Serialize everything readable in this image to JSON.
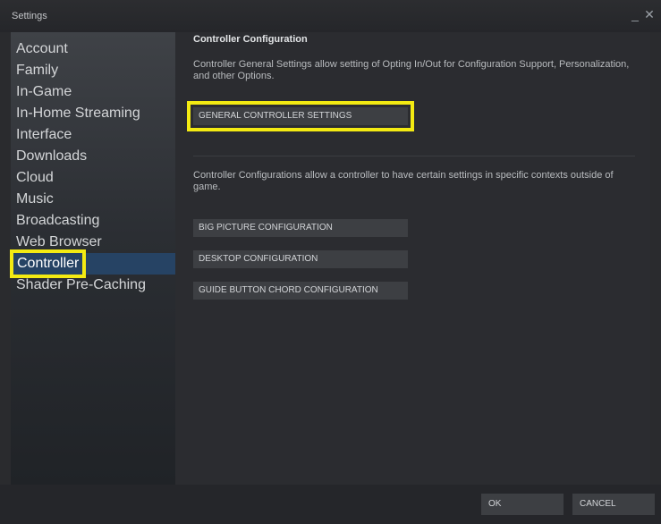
{
  "window": {
    "title": "Settings",
    "minimize_glyph": "_",
    "close_glyph": "✕"
  },
  "sidebar": {
    "items": [
      {
        "label": "Account"
      },
      {
        "label": "Family"
      },
      {
        "label": "In-Game"
      },
      {
        "label": "In-Home Streaming"
      },
      {
        "label": "Interface"
      },
      {
        "label": "Downloads"
      },
      {
        "label": "Cloud"
      },
      {
        "label": "Music"
      },
      {
        "label": "Broadcasting"
      },
      {
        "label": "Web Browser"
      },
      {
        "label": "Controller"
      },
      {
        "label": "Shader Pre-Caching"
      }
    ],
    "selected": "Controller"
  },
  "main": {
    "title": "Controller Configuration",
    "general_description": "Controller General Settings allow setting of Opting In/Out for Configuration Support, Personalization, and other Options.",
    "general_button": "GENERAL CONTROLLER SETTINGS",
    "configs_description": "Controller Configurations allow a controller to have certain settings in specific contexts outside of game.",
    "big_picture_button": "BIG PICTURE CONFIGURATION",
    "desktop_button": "DESKTOP CONFIGURATION",
    "guide_chord_button": "GUIDE BUTTON CHORD CONFIGURATION"
  },
  "footer": {
    "ok_label": "OK",
    "cancel_label": "CANCEL"
  },
  "colors": {
    "highlight_box": "#f3ea12",
    "selected_item": "#264364",
    "background": "#2a2b2e"
  }
}
